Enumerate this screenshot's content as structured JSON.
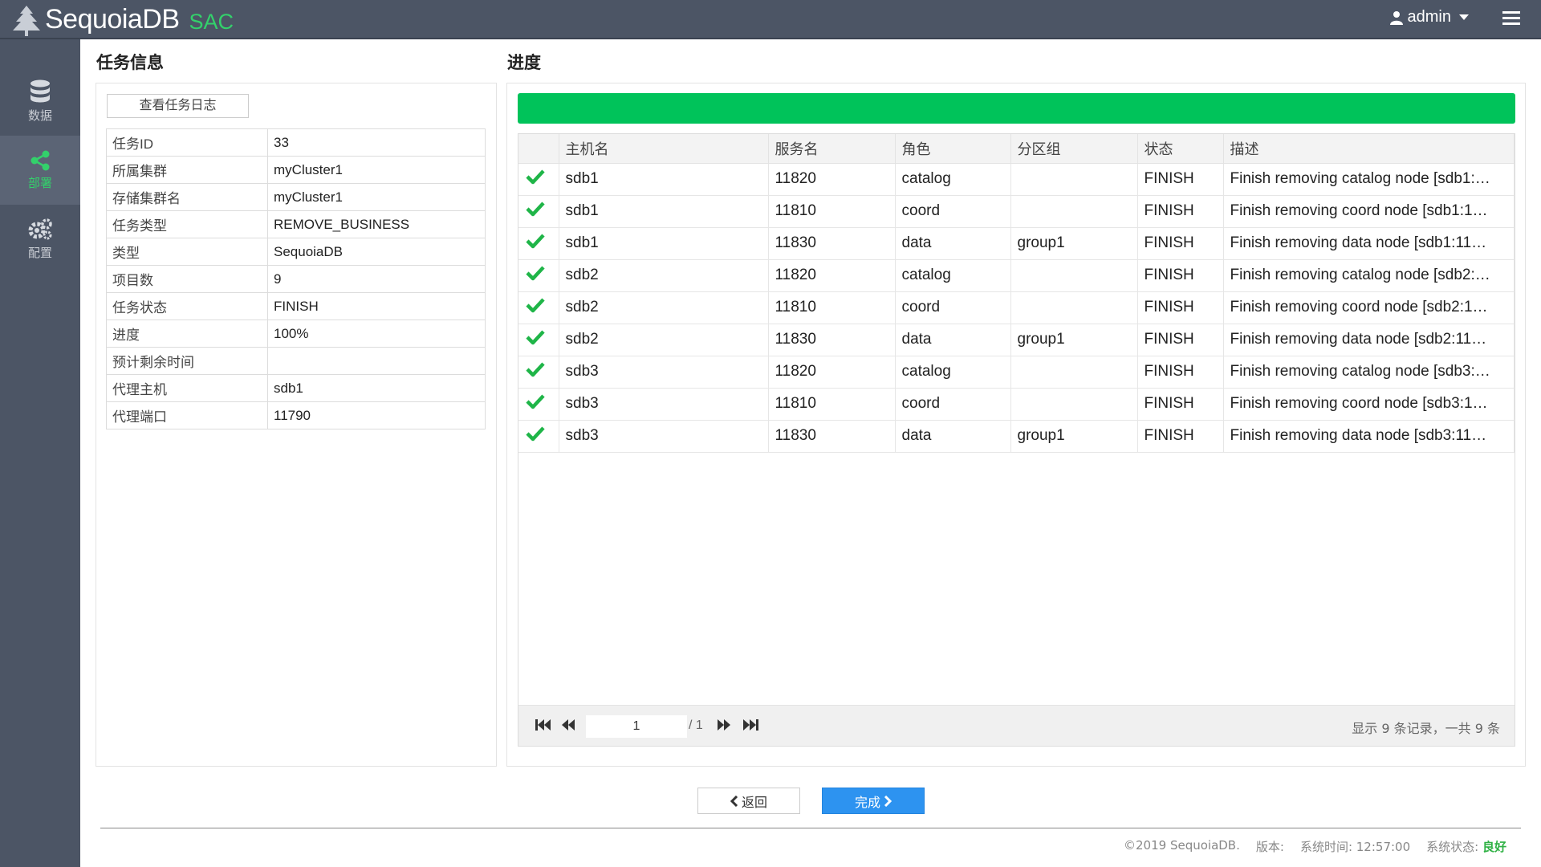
{
  "header": {
    "brand": "SequoiaDB",
    "brand_sub": "SAC",
    "user": "admin",
    "colors": {
      "bar": "#4c5565",
      "accent": "#33d16b"
    }
  },
  "sidebar": {
    "items": [
      {
        "label": "数据",
        "icon": "database-icon",
        "active": false
      },
      {
        "label": "部署",
        "icon": "share-icon",
        "active": true
      },
      {
        "label": "配置",
        "icon": "gears-icon",
        "active": false
      }
    ]
  },
  "task_info": {
    "title": "任务信息",
    "log_button": "查看任务日志",
    "rows": [
      {
        "key": "任务ID",
        "value": "33"
      },
      {
        "key": "所属集群",
        "value": "myCluster1"
      },
      {
        "key": "存储集群名",
        "value": "myCluster1"
      },
      {
        "key": "任务类型",
        "value": "REMOVE_BUSINESS"
      },
      {
        "key": "类型",
        "value": "SequoiaDB"
      },
      {
        "key": "项目数",
        "value": "9"
      },
      {
        "key": "任务状态",
        "value": "FINISH"
      },
      {
        "key": "进度",
        "value": "100%"
      },
      {
        "key": "预计剩余时间",
        "value": ""
      },
      {
        "key": "代理主机",
        "value": "sdb1"
      },
      {
        "key": "代理端口",
        "value": "11790"
      }
    ]
  },
  "progress": {
    "title": "进度",
    "percent": 100,
    "columns": [
      "",
      "主机名",
      "服务名",
      "角色",
      "分区组",
      "状态",
      "描述"
    ],
    "rows": [
      {
        "host": "sdb1",
        "svc": "11820",
        "role": "catalog",
        "group": "",
        "status": "FINISH",
        "desc": "Finish removing catalog node [sdb1:…"
      },
      {
        "host": "sdb1",
        "svc": "11810",
        "role": "coord",
        "group": "",
        "status": "FINISH",
        "desc": "Finish removing coord node [sdb1:1…"
      },
      {
        "host": "sdb1",
        "svc": "11830",
        "role": "data",
        "group": "group1",
        "status": "FINISH",
        "desc": "Finish removing data node [sdb1:11…"
      },
      {
        "host": "sdb2",
        "svc": "11820",
        "role": "catalog",
        "group": "",
        "status": "FINISH",
        "desc": "Finish removing catalog node [sdb2:…"
      },
      {
        "host": "sdb2",
        "svc": "11810",
        "role": "coord",
        "group": "",
        "status": "FINISH",
        "desc": "Finish removing coord node [sdb2:1…"
      },
      {
        "host": "sdb2",
        "svc": "11830",
        "role": "data",
        "group": "group1",
        "status": "FINISH",
        "desc": "Finish removing data node [sdb2:11…"
      },
      {
        "host": "sdb3",
        "svc": "11820",
        "role": "catalog",
        "group": "",
        "status": "FINISH",
        "desc": "Finish removing catalog node [sdb3:…"
      },
      {
        "host": "sdb3",
        "svc": "11810",
        "role": "coord",
        "group": "",
        "status": "FINISH",
        "desc": "Finish removing coord node [sdb3:1…"
      },
      {
        "host": "sdb3",
        "svc": "11830",
        "role": "data",
        "group": "group1",
        "status": "FINISH",
        "desc": "Finish removing data node [sdb3:11…"
      }
    ],
    "pager": {
      "page": "1",
      "total": "/ 1",
      "info": "显示 9 条记录，一共 9 条"
    }
  },
  "actions": {
    "back": "返回",
    "done": "完成"
  },
  "footer": {
    "copyright": "©2019 SequoiaDB.",
    "version": "版本:",
    "time": "系统时间: 12:57:00",
    "status_label": "系统状态:",
    "status_value": "良好"
  }
}
